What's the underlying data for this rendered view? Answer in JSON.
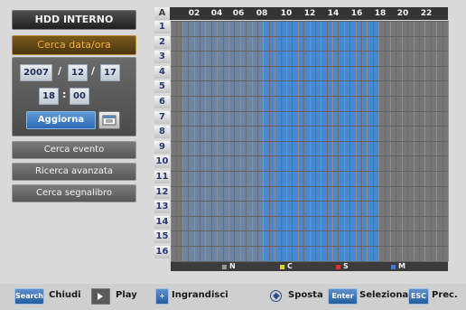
{
  "left_panel": {
    "title": "HDD INTERNO",
    "section_title": "Cerca data/ora",
    "date": {
      "year": "2007",
      "month": "12",
      "day": "17",
      "hour": "18",
      "minute": "00"
    },
    "update_button": "Aggiorna",
    "calendar_icon": "calendar-icon",
    "buttons": [
      "Cerca evento",
      "Ricerca avanzata",
      "Cerca segnalibro"
    ]
  },
  "grid": {
    "corner_label": "A",
    "hours": [
      "02",
      "04",
      "06",
      "08",
      "10",
      "12",
      "14",
      "16",
      "18",
      "20",
      "22"
    ],
    "rows": [
      "1",
      "2",
      "3",
      "4",
      "5",
      "6",
      "7",
      "8",
      "9",
      "10",
      "11",
      "12",
      "13",
      "14",
      "15",
      "16"
    ],
    "recording_span": {
      "partial_start_hour": 1,
      "partial_end_hour": 8,
      "continuous_start_hour": 8,
      "continuous_end_hour": 18
    }
  },
  "legend": [
    {
      "label": "N",
      "color": "#9a9a9a"
    },
    {
      "label": "C",
      "color": "#d6d62a"
    },
    {
      "label": "S",
      "color": "#ea2a2a"
    },
    {
      "label": "M",
      "color": "#3b79d3"
    }
  ],
  "bottom_bar": {
    "search_label": "Search",
    "close_label": "Chiudi",
    "play_label": "Play",
    "plus_label": "+",
    "zoom_label": "Ingrandisci",
    "move_label": "Sposta",
    "enter_label": "Enter",
    "select_label": "Seleziona",
    "esc_label": "ESC",
    "prev_label": "Prec."
  }
}
